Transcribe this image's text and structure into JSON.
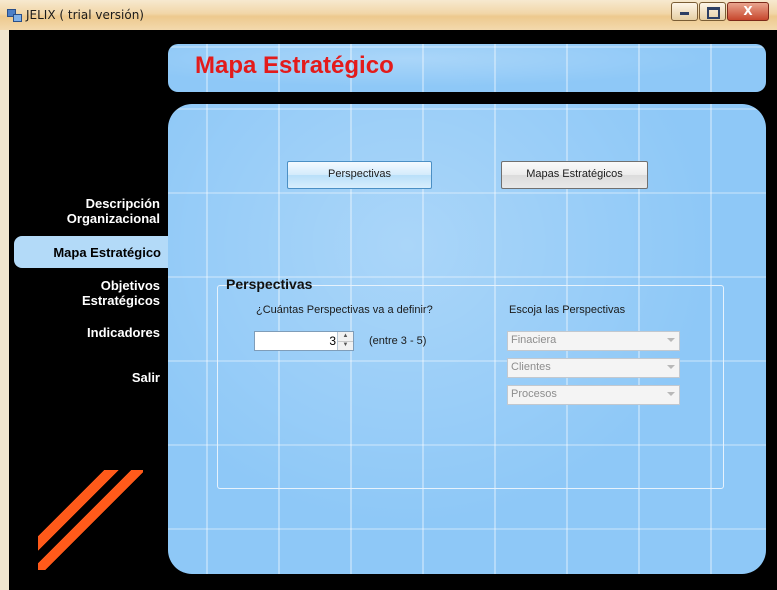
{
  "window": {
    "title": "JELIX ( trial versión)",
    "controls": {
      "minimize": "–",
      "maximize": "□",
      "close": "X"
    }
  },
  "header": {
    "title": "Mapa Estratégico"
  },
  "sidebar": {
    "items": [
      {
        "label_line1": "Descripción",
        "label_line2": "Organizacional"
      },
      {
        "label": "Mapa Estratégico",
        "active": true
      },
      {
        "label_line1": "Objetivos",
        "label_line2": "Estratégicos"
      },
      {
        "label": "Indicadores"
      },
      {
        "label": "Salir"
      }
    ]
  },
  "toolbar": {
    "perspectivas_button": "Perspectivas",
    "mapas_button": "Mapas Estratégicos"
  },
  "perspectivas_group": {
    "title": "Perspectivas",
    "count_question": "¿Cuántas Perspectivas va a definir?",
    "count_value": "3",
    "count_range": "(entre 3 - 5)",
    "choose_label": "Escoja las Perspectivas",
    "combos": [
      "Finaciera",
      "Clientes",
      "Procesos"
    ]
  },
  "colors": {
    "title_red": "#e31b1b",
    "panel_blue": "#8ec8f7",
    "stripe_orange": "#ff5a1a",
    "sidebar_active": "#b3daf8"
  }
}
